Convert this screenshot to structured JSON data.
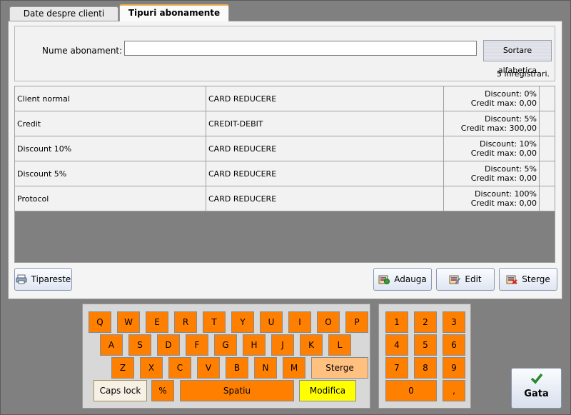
{
  "tabs": [
    {
      "label": "Date despre clienti",
      "active": false
    },
    {
      "label": "Tipuri abonamente",
      "active": true
    }
  ],
  "filter": {
    "label": "Nume abonament:",
    "value": "",
    "sort_button": "Sortare alfabetica",
    "record_count": "5 inregistrari."
  },
  "rows": [
    {
      "name": "Client normal",
      "type": "CARD REDUCERE",
      "discount": "Discount: 0%",
      "credit": "Credit max: 0,00"
    },
    {
      "name": "Credit",
      "type": "CREDIT-DEBIT",
      "discount": "Discount: 5%",
      "credit": "Credit max: 300,00"
    },
    {
      "name": "Discount 10%",
      "type": "CARD REDUCERE",
      "discount": "Discount: 10%",
      "credit": "Credit max: 0,00"
    },
    {
      "name": "Discount 5%",
      "type": "CARD REDUCERE",
      "discount": "Discount: 5%",
      "credit": "Credit max: 0,00"
    },
    {
      "name": "Protocol",
      "type": "CARD REDUCERE",
      "discount": "Discount: 100%",
      "credit": "Credit max: 0,00"
    }
  ],
  "actions": {
    "print": "Tipareste",
    "add": "Adauga",
    "edit": "Edit",
    "delete": "Sterge"
  },
  "keyboard": {
    "row1": [
      "Q",
      "W",
      "E",
      "R",
      "T",
      "Y",
      "U",
      "I",
      "O",
      "P"
    ],
    "row2": [
      "A",
      "S",
      "D",
      "F",
      "G",
      "H",
      "J",
      "K",
      "L"
    ],
    "row3": [
      "Z",
      "X",
      "C",
      "V",
      "B",
      "N",
      "M"
    ],
    "backspace": "Sterge",
    "caps": "Caps lock",
    "percent": "%",
    "space": "Spatiu",
    "modify": "Modifica"
  },
  "numpad": {
    "keys": [
      "1",
      "2",
      "3",
      "4",
      "5",
      "6",
      "7",
      "8",
      "9"
    ],
    "zero": "0",
    "comma": ","
  },
  "done": "Gata",
  "colors": {
    "key": "#ff7f00",
    "key_light": "#ffc080",
    "modify": "#ffff00",
    "tab_accent": "#f0b04a"
  }
}
